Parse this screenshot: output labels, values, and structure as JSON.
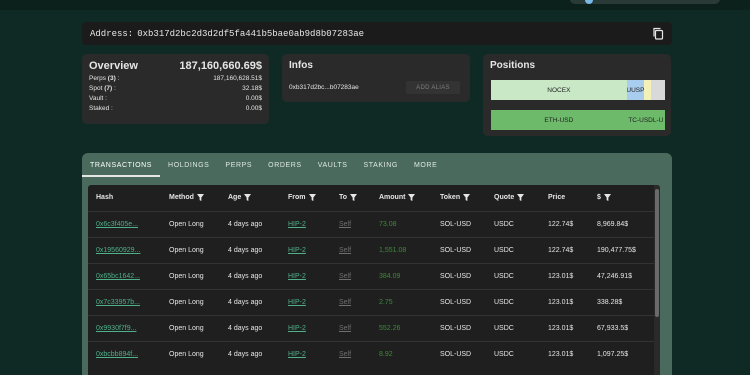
{
  "address": {
    "label": "Address:",
    "value": "0xb317d2bc2d3d2df5fa441b5bae0ab9d8b07283ae"
  },
  "overview": {
    "title": "Overview",
    "total": "187,160,660.69$",
    "rows": [
      {
        "label": "Perps",
        "count": "(3)",
        "suffix": " :",
        "value": "187,160,628.51$"
      },
      {
        "label": "Spot",
        "count": "(7)",
        "suffix": " :",
        "value": "32.18$"
      },
      {
        "label": "Vault",
        "count": "",
        "suffix": " :",
        "value": "0.00$"
      },
      {
        "label": "Staked",
        "count": "",
        "suffix": " :",
        "value": "0.00$"
      }
    ]
  },
  "infos": {
    "title": "Infos",
    "short_address": "0xb317d2bc...b07283ae",
    "alias_button": "ADD ALIAS"
  },
  "positions": {
    "title": "Positions",
    "bar1": [
      {
        "label": "NOCEX",
        "fraction": 0.78,
        "color": "#c8e8c6"
      },
      {
        "label": "UUSP",
        "fraction": 0.1,
        "color": "#a9cdee"
      },
      {
        "label": "",
        "fraction": 0.04,
        "color": "#f3f1b8"
      },
      {
        "label": "",
        "fraction": 0.08,
        "color": "#d9d9d9"
      }
    ],
    "bar2": [
      {
        "label": "ETH-USD",
        "fraction": 0.78,
        "color": "#6cba6a"
      },
      {
        "label": "TC-USDL-U",
        "fraction": 0.22,
        "color": "#6cba6a"
      }
    ]
  },
  "tabs": [
    "TRANSACTIONS",
    "HOLDINGS",
    "PERPS",
    "ORDERS",
    "VAULTS",
    "STAKING",
    "MORE"
  ],
  "table": {
    "headers": {
      "hash": "Hash",
      "method": "Method",
      "age": "Age",
      "from": "From",
      "to": "To",
      "amount": "Amount",
      "token": "Token",
      "quote": "Quote",
      "price": "Price",
      "usd": "$"
    },
    "rows": [
      {
        "hash": "0x6c3f405e...",
        "method": "Open Long",
        "age": "4 days ago",
        "from": "HIP-2",
        "to": "Self",
        "amount": "73.08",
        "token": "SOL-USD",
        "quote": "USDC",
        "price": "122.74$",
        "usd": "8,969.84$"
      },
      {
        "hash": "0x19560929...",
        "method": "Open Long",
        "age": "4 days ago",
        "from": "HIP-2",
        "to": "Self",
        "amount": "1,551.08",
        "token": "SOL-USD",
        "quote": "USDC",
        "price": "122.74$",
        "usd": "190,477.75$"
      },
      {
        "hash": "0x65bc1642...",
        "method": "Open Long",
        "age": "4 days ago",
        "from": "HIP-2",
        "to": "Self",
        "amount": "384.09",
        "token": "SOL-USD",
        "quote": "USDC",
        "price": "123.01$",
        "usd": "47,246.91$"
      },
      {
        "hash": "0x7c33957b...",
        "method": "Open Long",
        "age": "4 days ago",
        "from": "HIP-2",
        "to": "Self",
        "amount": "2.75",
        "token": "SOL-USD",
        "quote": "USDC",
        "price": "123.01$",
        "usd": "338.28$"
      },
      {
        "hash": "0x9930f7f9...",
        "method": "Open Long",
        "age": "4 days ago",
        "from": "HIP-2",
        "to": "Self",
        "amount": "552.26",
        "token": "SOL-USD",
        "quote": "USDC",
        "price": "123.01$",
        "usd": "67,933.5$"
      },
      {
        "hash": "0xbcbb894f...",
        "method": "Open Long",
        "age": "4 days ago",
        "from": "HIP-2",
        "to": "Self",
        "amount": "8.92",
        "token": "SOL-USD",
        "quote": "USDC",
        "price": "123.01$",
        "usd": "1,097.25$"
      }
    ]
  },
  "colors": {
    "background": "#0f2a24",
    "card": "#2a2a2a",
    "panel": "#4a6a5e",
    "link": "#4fb08a",
    "amount": "#3e8a3a"
  }
}
